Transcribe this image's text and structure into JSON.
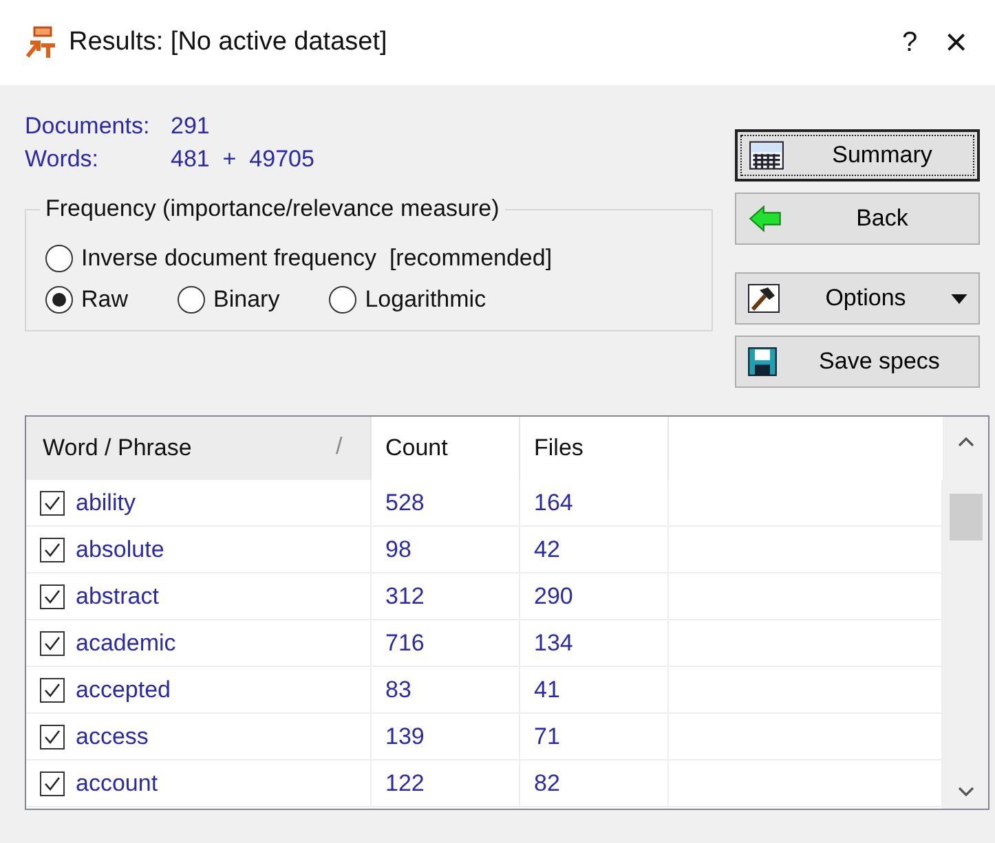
{
  "window": {
    "title": "Results: [No active dataset]",
    "help": "?",
    "close": "×"
  },
  "stats": [
    {
      "label": "Documents:",
      "value": "291"
    },
    {
      "label": "Words:",
      "value": "481  +  49705"
    }
  ],
  "frequency": {
    "title": "Frequency (importance/relevance measure)",
    "options": [
      {
        "label": "Inverse document frequency  [recommended]",
        "selected": false
      },
      {
        "label": "Raw",
        "selected": true
      },
      {
        "label": "Binary",
        "selected": false
      },
      {
        "label": "Logarithmic",
        "selected": false
      }
    ]
  },
  "buttons": [
    {
      "kind": "summary",
      "label": "Summary",
      "focused": true
    },
    {
      "kind": "back",
      "label": "Back",
      "focused": false
    },
    {
      "kind": "options",
      "label": "Options",
      "focused": false
    },
    {
      "kind": "save",
      "label": "Save specs",
      "focused": false
    }
  ],
  "table": {
    "columns": [
      "Word / Phrase",
      "Count",
      "Files"
    ],
    "sort_mark": "/",
    "rows": [
      {
        "word": "ability",
        "checked": true,
        "count": "528",
        "files": "164"
      },
      {
        "word": "absolute",
        "checked": true,
        "count": "98",
        "files": "42"
      },
      {
        "word": "abstract",
        "checked": true,
        "count": "312",
        "files": "290"
      },
      {
        "word": "academic",
        "checked": true,
        "count": "716",
        "files": "134"
      },
      {
        "word": "accepted",
        "checked": true,
        "count": "83",
        "files": "41"
      },
      {
        "word": "access",
        "checked": true,
        "count": "139",
        "files": "71"
      },
      {
        "word": "account",
        "checked": true,
        "count": "122",
        "files": "82"
      }
    ]
  }
}
